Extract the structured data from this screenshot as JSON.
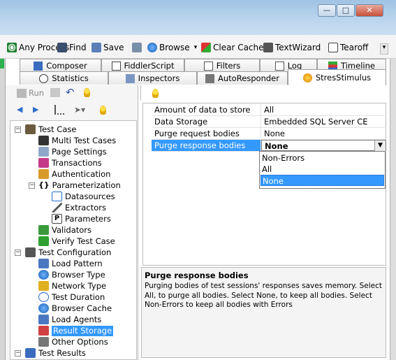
{
  "window": {
    "minimize": "—",
    "maximize": "□",
    "close": "✕"
  },
  "toolbar": {
    "any_process": "Any Process",
    "find": "Find",
    "save": "Save",
    "browse": "Browse",
    "clear_cache": "Clear Cache",
    "textwizard": "TextWizard",
    "tearoff": "Tearoff"
  },
  "tabs_row1": [
    "Composer",
    "FiddlerScript",
    "Filters",
    "Log",
    "Timeline"
  ],
  "tabs_row2": [
    "Statistics",
    "Inspectors",
    "AutoResponder",
    "StresStimulus"
  ],
  "left_toolbar": {
    "run": "Run"
  },
  "tree": {
    "test_case": "Test Case",
    "multi_test_cases": "Multi Test Cases",
    "page_settings": "Page Settings",
    "transactions": "Transactions",
    "authentication": "Authentication",
    "parameterization": "Parameterization",
    "datasources": "Datasources",
    "extractors": "Extractors",
    "parameters": "Parameters",
    "validators": "Validators",
    "verify_test_case": "Verify Test Case",
    "test_configuration": "Test Configuration",
    "load_pattern": "Load Pattern",
    "browser_type": "Browser Type",
    "network_type": "Network Type",
    "test_duration": "Test Duration",
    "browser_cache": "Browser Cache",
    "load_agents": "Load Agents",
    "result_storage": "Result Storage",
    "other_options": "Other Options",
    "test_results": "Test Results"
  },
  "properties": [
    {
      "name": "Amount of data to store",
      "value": "All"
    },
    {
      "name": "Data Storage",
      "value": "Embedded SQL Server CE"
    },
    {
      "name": "Purge request bodies",
      "value": "None"
    },
    {
      "name": "Purge response bodies",
      "value": "None"
    }
  ],
  "dropdown_options": [
    "Non-Errors",
    "All",
    "None"
  ],
  "help": {
    "title": "Purge response bodies",
    "text": "Purging bodies of test sessions' responses saves memory. Select All, to purge all bodies. Select None, to keep all bodies. Select Non-Errors to keep all bodies with Errors"
  },
  "colors": {
    "selection": "#3399ff",
    "accent": "#2a6cc8"
  }
}
